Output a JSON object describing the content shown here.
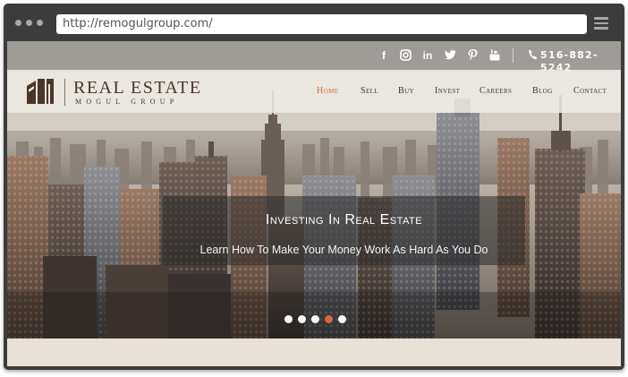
{
  "browser": {
    "url": "http://remogulgroup.com/",
    "menu_icon": "hamburger-icon"
  },
  "topbar": {
    "social_icons": [
      "facebook-icon",
      "instagram-icon",
      "linkedin-icon",
      "twitter-icon",
      "pinterest-icon",
      "youtube-icon"
    ],
    "phone_icon": "phone-icon",
    "phone": "516-882-5242"
  },
  "brand": {
    "title": "REAL ESTATE",
    "subtitle": "MOGUL GROUP",
    "logo_icon": "rm-logo-icon"
  },
  "nav": {
    "items": [
      {
        "label": "Home",
        "active": true
      },
      {
        "label": "Sell",
        "active": false
      },
      {
        "label": "Buy",
        "active": false
      },
      {
        "label": "Invest",
        "active": false
      },
      {
        "label": "Careers",
        "active": false
      },
      {
        "label": "Blog",
        "active": false
      },
      {
        "label": "Contact",
        "active": false
      }
    ]
  },
  "hero": {
    "title": "Investing In Real Estate",
    "subtitle": "Learn How To Make Your Money Work As Hard As You Do",
    "slides_total": 5,
    "active_slide": 4
  },
  "colors": {
    "accent": "#d16b3a",
    "brand_brown": "#4a3628",
    "frame": "#3c3c3c",
    "band": "#e9e1d7"
  }
}
